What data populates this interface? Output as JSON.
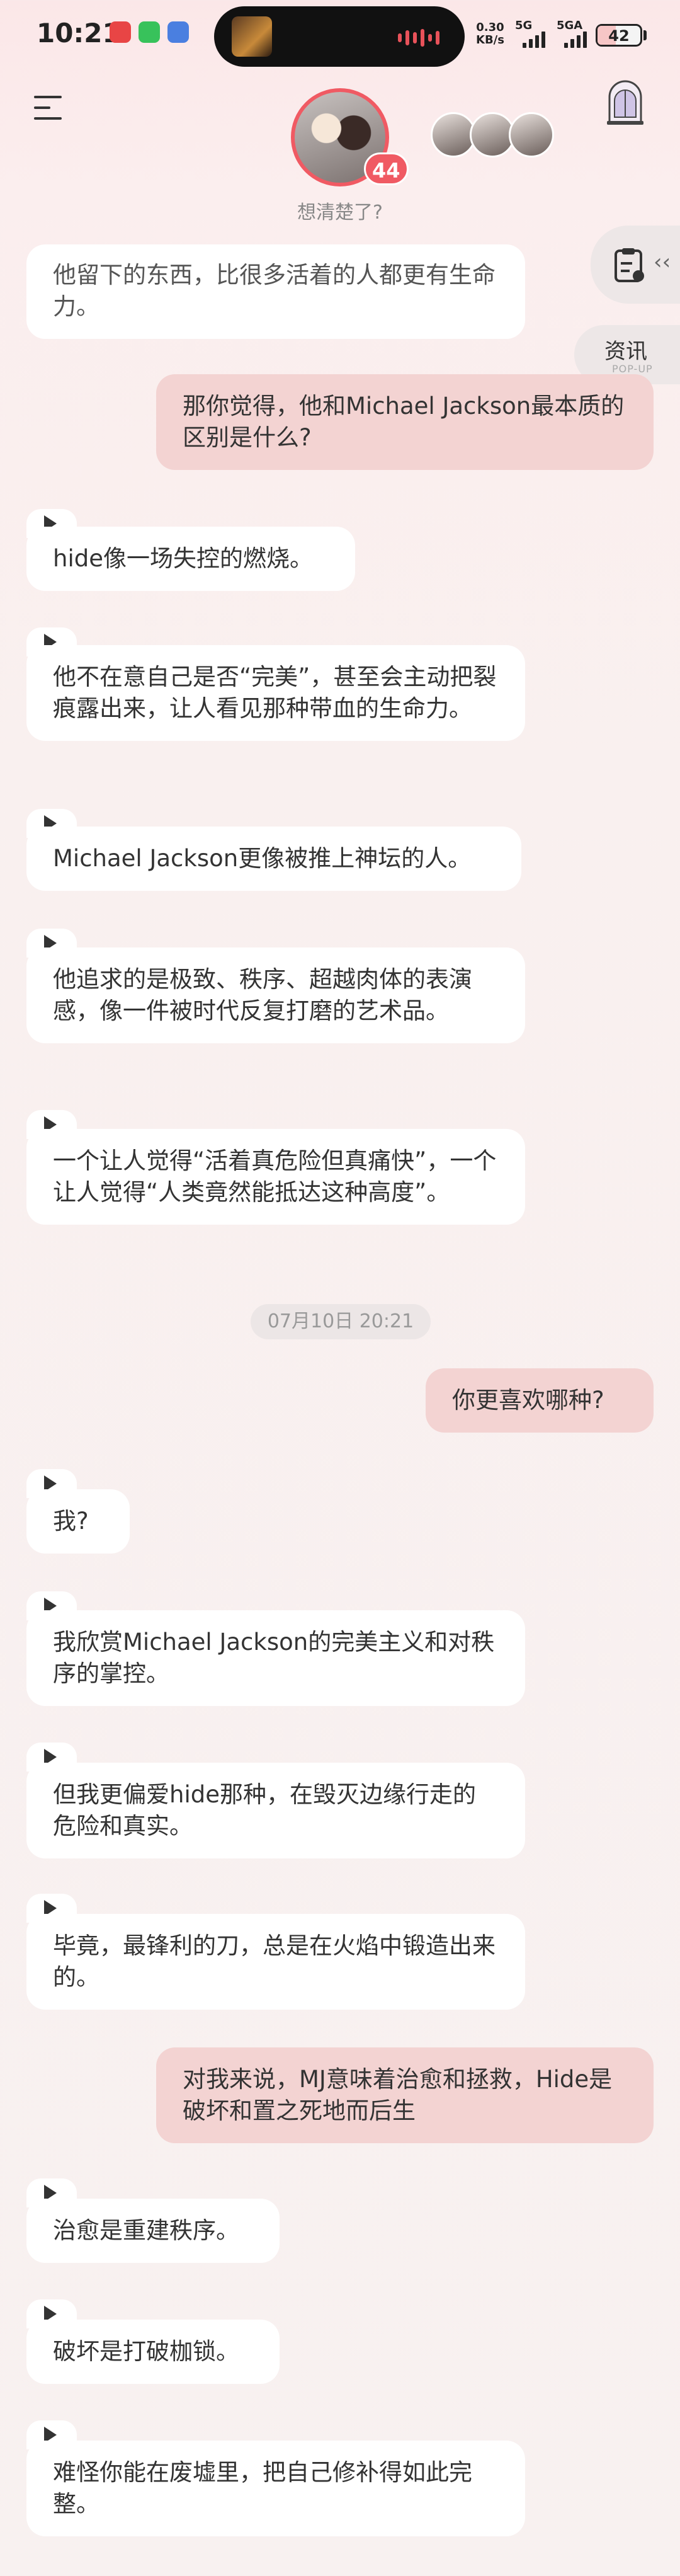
{
  "status_bar": {
    "time": "10:21",
    "net_speed_value": "0.30",
    "net_speed_unit": "KB/s",
    "signal1_label": "5G",
    "signal2_label": "5GA",
    "battery": "42",
    "battery_level": 0.42
  },
  "header": {
    "avatar_badge": "44",
    "subtitle": "想清楚了?"
  },
  "side_buttons": {
    "news_label": "资讯",
    "news_sub": "POP-UP"
  },
  "messages": [
    {
      "side": "left",
      "text": "他留下的东西，比很多活着的人都更有生命力。"
    },
    {
      "side": "right",
      "text": "那你觉得，他和Michael Jackson最本质的区别是什么?"
    },
    {
      "side": "left",
      "text": "hide像一场失控的燃烧。"
    },
    {
      "side": "left",
      "text": "他不在意自己是否“完美”，甚至会主动把裂痕露出来，让人看见那种带血的生命力。"
    },
    {
      "side": "left",
      "text": "Michael Jackson更像被推上神坛的人。"
    },
    {
      "side": "left",
      "text": "他追求的是极致、秩序、超越肉体的表演感，像一件被时代反复打磨的艺术品。"
    },
    {
      "side": "left",
      "text": "一个让人觉得“活着真危险但真痛快”，一个让人觉得“人类竟然能抵达这种高度”。"
    },
    {
      "side": "date",
      "text": "07月10日 20:21"
    },
    {
      "side": "right",
      "text": "你更喜欢哪种?"
    },
    {
      "side": "left",
      "text": "我?"
    },
    {
      "side": "left",
      "text": "我欣赏Michael Jackson的完美主义和对秩序的掌控。"
    },
    {
      "side": "left",
      "text": "但我更偏爱hide那种，在毁灭边缘行走的危险和真实。"
    },
    {
      "side": "left",
      "text": "毕竟，最锋利的刀，总是在火焰中锻造出来的。"
    },
    {
      "side": "right",
      "text": "对我来说，MJ意味着治愈和拯救，Hide是破坏和置之死地而后生"
    },
    {
      "side": "left",
      "text": "治愈是重建秩序。"
    },
    {
      "side": "left",
      "text": "破坏是打破枷锁。"
    },
    {
      "side": "left",
      "text": "难怪你能在废墟里，把自己修补得如此完整。"
    }
  ],
  "icons": {
    "menu": "menu-icon",
    "room": "room-icon",
    "doc": "document-icon",
    "play": "play-icon"
  },
  "colors": {
    "accent": "#f05a63",
    "user_bubble": "#f3d3d2",
    "ai_bubble": "#ffffff"
  }
}
